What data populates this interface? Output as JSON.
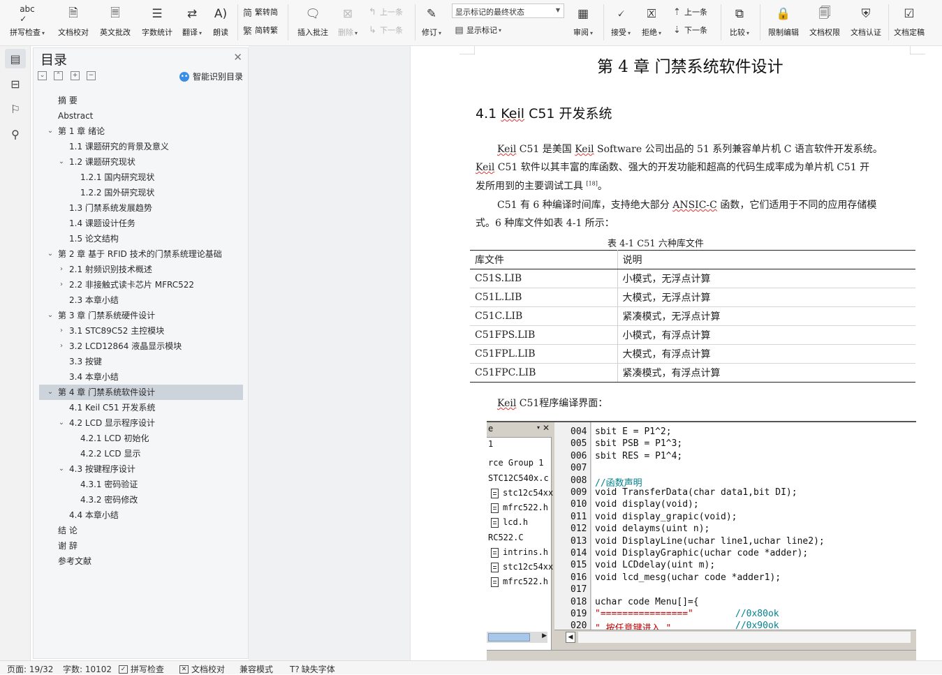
{
  "ribbon": {
    "spell_check": "拼写检查",
    "doc_proof": "文档校对",
    "english_review": "英文批改",
    "word_count": "字数统计",
    "translate": "翻译",
    "read_aloud": "朗读",
    "to_traditional": "繁转简",
    "to_simplified": "简转繁",
    "insert_comment": "插入批注",
    "delete": "删除",
    "prev_comment": "上一条",
    "next_comment": "下一条",
    "revision": "修订",
    "display_status": "显示标记的最终状态",
    "show_markup": "显示标记",
    "review": "审阅",
    "accept": "接受",
    "reject": "拒绝",
    "prev_change": "上一条",
    "next_change": "下一条",
    "compare": "比较",
    "restrict_edit": "限制编辑",
    "doc_permission": "文档权限",
    "doc_certify": "文档认证",
    "doc_finalize": "文档定稿"
  },
  "nav": {
    "title": "目录",
    "smart_toc": "智能识别目录",
    "items": [
      {
        "text": "摘  要",
        "level": 1,
        "toggle": ""
      },
      {
        "text": "Abstract",
        "level": 1,
        "toggle": ""
      },
      {
        "text": "第 1 章  绪论",
        "level": 1,
        "toggle": "open"
      },
      {
        "text": "1.1  课题研究的背景及意义",
        "level": 2,
        "toggle": ""
      },
      {
        "text": "1.2  课题研究现状",
        "level": 2,
        "toggle": "open"
      },
      {
        "text": "1.2.1  国内研究现状",
        "level": 3,
        "toggle": ""
      },
      {
        "text": "1.2.2  国外研究现状",
        "level": 3,
        "toggle": ""
      },
      {
        "text": "1.3  门禁系统发展趋势",
        "level": 2,
        "toggle": ""
      },
      {
        "text": "1.4  课题设计任务",
        "level": 2,
        "toggle": ""
      },
      {
        "text": "1.5  论文结构",
        "level": 2,
        "toggle": ""
      },
      {
        "text": "第 2 章  基于 RFID 技术的门禁系统理论基础",
        "level": 1,
        "toggle": "open"
      },
      {
        "text": "2.1  射频识别技术概述",
        "level": 2,
        "toggle": "closed"
      },
      {
        "text": "2.2  非接触式读卡芯片 MFRC522",
        "level": 2,
        "toggle": "closed"
      },
      {
        "text": "2.3  本章小结",
        "level": 2,
        "toggle": ""
      },
      {
        "text": "第 3 章  门禁系统硬件设计",
        "level": 1,
        "toggle": "open"
      },
      {
        "text": "3.1 STC89C52 主控模块",
        "level": 2,
        "toggle": "closed"
      },
      {
        "text": "3.2 LCD12864 液晶显示模块",
        "level": 2,
        "toggle": "closed"
      },
      {
        "text": "3.3  按键",
        "level": 2,
        "toggle": ""
      },
      {
        "text": "3.4  本章小结",
        "level": 2,
        "toggle": ""
      },
      {
        "text": "第 4 章  门禁系统软件设计",
        "level": 1,
        "toggle": "open",
        "selected": true
      },
      {
        "text": "4.1 Keil  C51 开发系统",
        "level": 2,
        "toggle": ""
      },
      {
        "text": "4.2 LCD 显示程序设计",
        "level": 2,
        "toggle": "open"
      },
      {
        "text": "4.2.1 LCD 初始化",
        "level": 3,
        "toggle": ""
      },
      {
        "text": "4.2.2 LCD 显示",
        "level": 3,
        "toggle": ""
      },
      {
        "text": "4.3 按键程序设计",
        "level": 2,
        "toggle": "open"
      },
      {
        "text": "4.3.1  密码验证",
        "level": 3,
        "toggle": ""
      },
      {
        "text": "4.3.2  密码修改",
        "level": 3,
        "toggle": ""
      },
      {
        "text": "4.4 本章小结",
        "level": 2,
        "toggle": ""
      },
      {
        "text": "结  论",
        "level": 1,
        "toggle": ""
      },
      {
        "text": "谢  辞",
        "level": 1,
        "toggle": ""
      },
      {
        "text": "参考文献",
        "level": 1,
        "toggle": ""
      }
    ]
  },
  "doc": {
    "chapter_title": "第 4 章  门禁系统软件设计",
    "section_pre": "4.1 ",
    "section_keil": "Keil",
    "section_post": " C51 开发系统",
    "p1_l1_a": "Keil",
    "p1_l1_b": " C51 是美国 ",
    "p1_l1_c": "Keil",
    "p1_l1_d": " Software 公司出品的 51 系列兼容单片机 C 语言软件开发系统。",
    "p1_l2_a": "Keil",
    "p1_l2_b": " C51 软件以其丰富的库函数、强大的开发功能和超高的代码生成率成为单片机 C51 开",
    "p1_l3": "发所用到的主要调试工具",
    "p1_ref": "[18]",
    "p1_end": "。",
    "p2_l1_a": "C51 有 6 种编译时间库，支持绝大部分 ",
    "p2_l1_b": "ANSIC-C",
    "p2_l1_c": " 函数，它们适用于不同的应用存储模",
    "p2_l2": "式。6 种库文件如表 4-1 所示：",
    "table_caption": "表 4-1  C51 六种库文件",
    "table_headers": [
      "库文件",
      "说明"
    ],
    "table_rows": [
      [
        "C51S.LIB",
        "小模式，无浮点计算"
      ],
      [
        "C51L.LIB",
        "大模式，无浮点计算"
      ],
      [
        "C51C.LIB",
        "紧凑模式，无浮点计算"
      ],
      [
        "C51FPS.LIB",
        "小模式，有浮点计算"
      ],
      [
        "C51FPL.LIB",
        "大模式，有浮点计算"
      ],
      [
        "C51FPC.LIB",
        "紧凑模式，有浮点计算"
      ]
    ],
    "p3_a": "Keil",
    "p3_b": "  C51程序编译界面："
  },
  "screenshot": {
    "project_items": [
      "e",
      "1",
      "rce Group 1",
      "STC12C540x.c",
      "stc12c54xx.",
      "mfrc522.h",
      "lcd.h",
      "RC522.C",
      "intrins.h",
      "stc12c54xx.",
      "mfrc522.h"
    ],
    "line_numbers": [
      "004",
      "005",
      "006",
      "007",
      "008",
      "009",
      "010",
      "011",
      "012",
      "013",
      "014",
      "015",
      "016",
      "017",
      "018",
      "019",
      "020"
    ],
    "code_lines": [
      "sbit E   = P1^2;",
      "sbit PSB = P1^3;",
      "sbit RES = P1^4;",
      "",
      "//函数声明",
      "void TransferData(char data1,bit DI);",
      "void display(void);",
      "void display_grapic(void);",
      "void delayms(uint n);",
      "void DisplayLine(uchar line1,uchar line2);",
      "void DisplayGraphic(uchar code *adder);",
      "void LCDdelay(uint m);",
      "void lcd_mesg(uchar code *adder1);",
      "",
      "uchar code Menu[]={",
      "\"================\"",
      "\"  按任意键进入  \""
    ],
    "code_comments": [
      "//0x80ok",
      "//0x90ok"
    ]
  },
  "status": {
    "page": "页面: 19/32",
    "words": "字数: 10102",
    "spell": "拼写检查",
    "proof": "文档校对",
    "compat": "兼容模式",
    "missing_font": "缺失字体"
  }
}
